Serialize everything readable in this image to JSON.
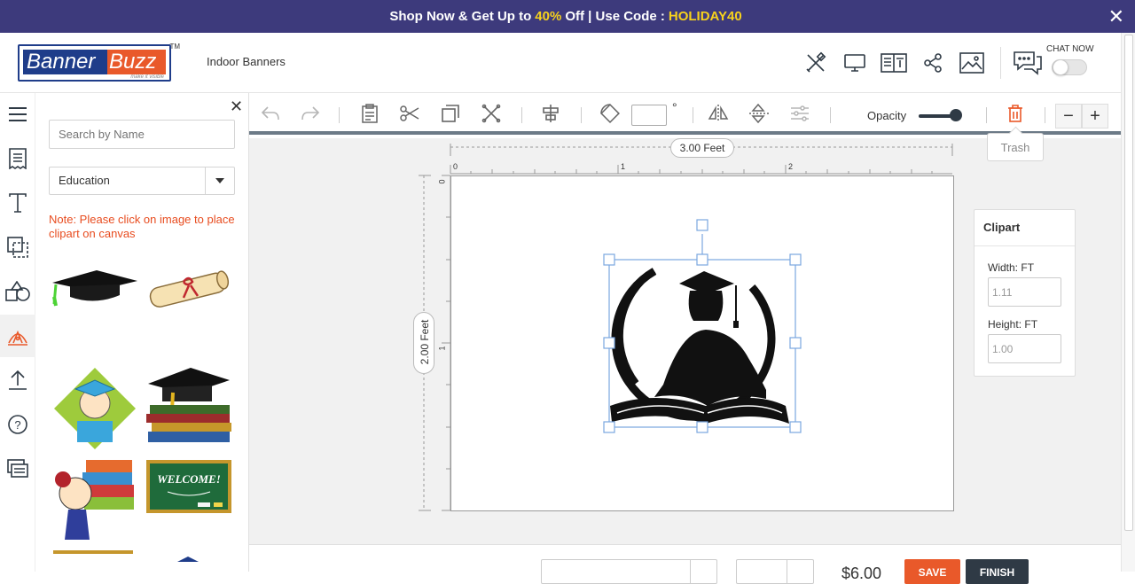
{
  "promo": {
    "text_before": "Shop Now & Get Up to",
    "discount": "40%",
    "text_middle": "Off | Use Code :",
    "code": "HOLIDAY40",
    "close_label": "✕"
  },
  "header": {
    "logo_part1": "Banner",
    "logo_part2": "Buzz",
    "logo_tagline": "make it visible",
    "logo_tm": "TM",
    "breadcrumb": "Indoor Banners",
    "icons": [
      "design-tools-icon",
      "monitor-icon",
      "book-icon",
      "share-icon",
      "image-icon"
    ],
    "chat_label": "CHAT NOW"
  },
  "leftbar": {
    "items": [
      "menu-icon",
      "templates-icon",
      "text-icon",
      "background-icon",
      "shapes-icon",
      "clipart-icon",
      "upload-icon",
      "help-icon",
      "more-icon"
    ],
    "active_index": 5
  },
  "panel": {
    "search_placeholder": "Search by Name",
    "category_selected": "Education",
    "note": "Note: Please click on image to place clipart on canvas",
    "clipart_items": [
      "graduation-cap",
      "diploma-scroll",
      "graduate-girl",
      "cap-on-books",
      "girl-with-books",
      "welcome-chalkboard"
    ]
  },
  "toolbar": {
    "angle_value": "",
    "degree_symbol": "°",
    "opacity_label": "Opacity",
    "opacity_value": 0.9,
    "trash_tooltip": "Trash",
    "zoom_out": "−",
    "zoom_in": "+"
  },
  "canvas": {
    "width_label": "3.00 Feet",
    "height_label": "2.00 Feet",
    "ruler_top": [
      "0",
      "1",
      "2"
    ],
    "ruler_left": [
      "0",
      "1"
    ]
  },
  "properties": {
    "title": "Clipart",
    "width_label": "Width:",
    "width_unit": "FT",
    "width_value": "1.11",
    "height_label": "Height:",
    "height_unit": "FT",
    "height_value": "1.00"
  },
  "bottom": {
    "material_value": "",
    "qty_value": "",
    "price": "$6.00",
    "save_label": "SAVE",
    "finish_label": "FINISH"
  },
  "colors": {
    "promo_bg": "#3d3a7c",
    "highlight": "#f7d21c",
    "brand_blue": "#1f3d8a",
    "brand_orange": "#e9592a",
    "note_red": "#e84c1f",
    "dark": "#2f3a45"
  }
}
